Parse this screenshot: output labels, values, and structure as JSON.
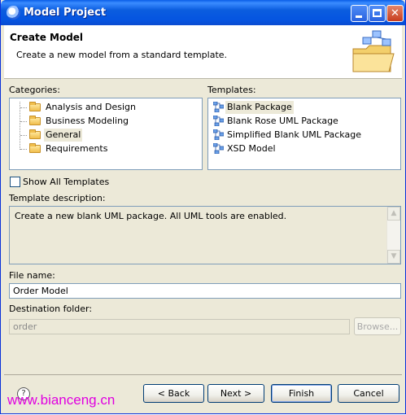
{
  "window": {
    "title": "Model Project"
  },
  "header": {
    "title": "Create Model",
    "description": "Create a new model from a standard template."
  },
  "categories": {
    "label": "Categories:",
    "items": [
      "Analysis and Design",
      "Business Modeling",
      "General",
      "Requirements"
    ],
    "selected": "General"
  },
  "templates": {
    "label": "Templates:",
    "items": [
      "Blank Package",
      "Blank Rose UML Package",
      "Simplified Blank UML Package",
      "XSD Model"
    ],
    "selected": "Blank Package"
  },
  "show_all": {
    "label": "Show All Templates",
    "checked": false
  },
  "template_description": {
    "label": "Template description:",
    "text": "Create a new blank UML package. All UML tools are enabled."
  },
  "file_name": {
    "label": "File name:",
    "value": "Order Model"
  },
  "destination": {
    "label": "Destination folder:",
    "value": "order",
    "browse_label": "Browse..."
  },
  "buttons": {
    "back": "< Back",
    "next": "Next >",
    "finish": "Finish",
    "cancel": "Cancel"
  },
  "watermark": "www.bianceng.cn"
}
